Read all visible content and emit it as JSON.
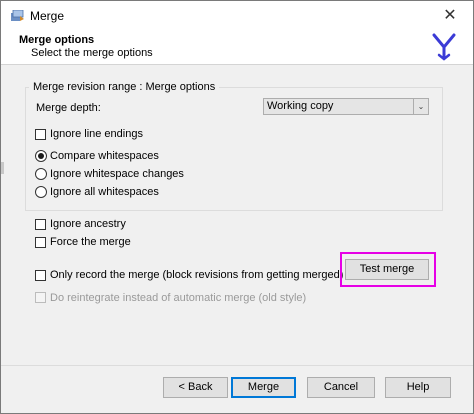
{
  "window": {
    "title": "Merge",
    "close_glyph": "✕"
  },
  "header": {
    "title": "Merge options",
    "subtitle": "Select the merge options"
  },
  "group": {
    "title": "Merge revision range : Merge options",
    "depth_label": "Merge depth:",
    "depth_value": "Working copy"
  },
  "options": {
    "ignore_line_endings": {
      "label": "Ignore line endings",
      "checked": false
    },
    "whitespace": [
      {
        "label": "Compare whitespaces",
        "selected": true
      },
      {
        "label": "Ignore whitespace changes",
        "selected": false
      },
      {
        "label": "Ignore all whitespaces",
        "selected": false
      }
    ],
    "ignore_ancestry": {
      "label": "Ignore ancestry",
      "checked": false
    },
    "force_merge": {
      "label": "Force the merge",
      "checked": false
    },
    "only_record": {
      "label": "Only record the merge (block revisions from getting merged)",
      "checked": false
    },
    "reintegrate": {
      "label": "Do reintegrate instead of automatic merge (old style)",
      "checked": false,
      "enabled": false
    }
  },
  "buttons": {
    "test_merge": "Test merge",
    "back": "< Back",
    "merge": "Merge",
    "cancel": "Cancel",
    "help": "Help"
  },
  "colors": {
    "highlight": "#e600e6",
    "accent": "#0078d7",
    "logo": "#3b3bd6"
  },
  "icons": {
    "app": "merge-app-icon",
    "logo": "tortoise-merge-logo",
    "dropdown": "chevron-down-icon"
  }
}
